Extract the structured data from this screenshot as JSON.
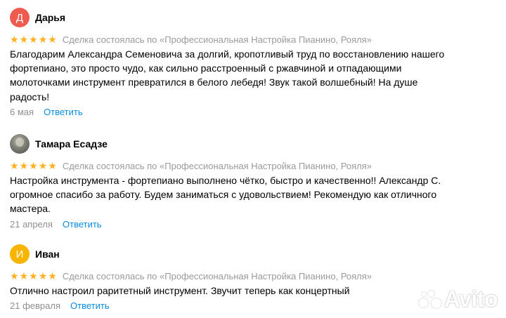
{
  "reviews": [
    {
      "avatar_letter": "Д",
      "avatar_color": "#ef5b4f",
      "author": "Дарья",
      "stars": [
        "★",
        "★",
        "★",
        "★",
        "★"
      ],
      "deal": "Сделка состоялась по «Профессиональная Настройка Пианино, Рояля»",
      "text": "Благодарим Александра Семеновича за долгий, кропотливый труд по восстановлению нашего фортепиано, это просто чудо, как сильно расстроенный с ржавчиной и отпадающими молоточками инструмент превратился в белого лебедя! Звук такой волшебный! На душе радость!",
      "date": "6 мая",
      "reply": "Ответить"
    },
    {
      "avatar_letter": "",
      "author": "Тамара Есадзе",
      "stars": [
        "★",
        "★",
        "★",
        "★",
        "★"
      ],
      "deal": "Сделка состоялась по «Профессиональная Настройка Пианино, Рояля»",
      "text": "Настройка инструмента - фортепиано выполнено чётко, быстро и качественно!! Александр С. огромное спасибо за работу. Будем заниматься с удовольствием! Рекомендую как отличного мастера.",
      "date": "21 апреля",
      "reply": "Ответить"
    },
    {
      "avatar_letter": "И",
      "avatar_color": "#f7b500",
      "author": "Иван",
      "stars": [
        "★",
        "★",
        "★",
        "★",
        "★"
      ],
      "deal": "Сделка состоялась по «Профессиональная Настройка Пианино, Рояля»",
      "text": "Отлично настроил раритетный инструмент. Звучит теперь как концертный",
      "date": "21 февраля",
      "reply": "Ответить"
    }
  ],
  "watermark": {
    "text": "Avito"
  },
  "colors": {
    "star": "#ffb021",
    "link": "#0a8be0",
    "meta": "#9a9a9a"
  }
}
